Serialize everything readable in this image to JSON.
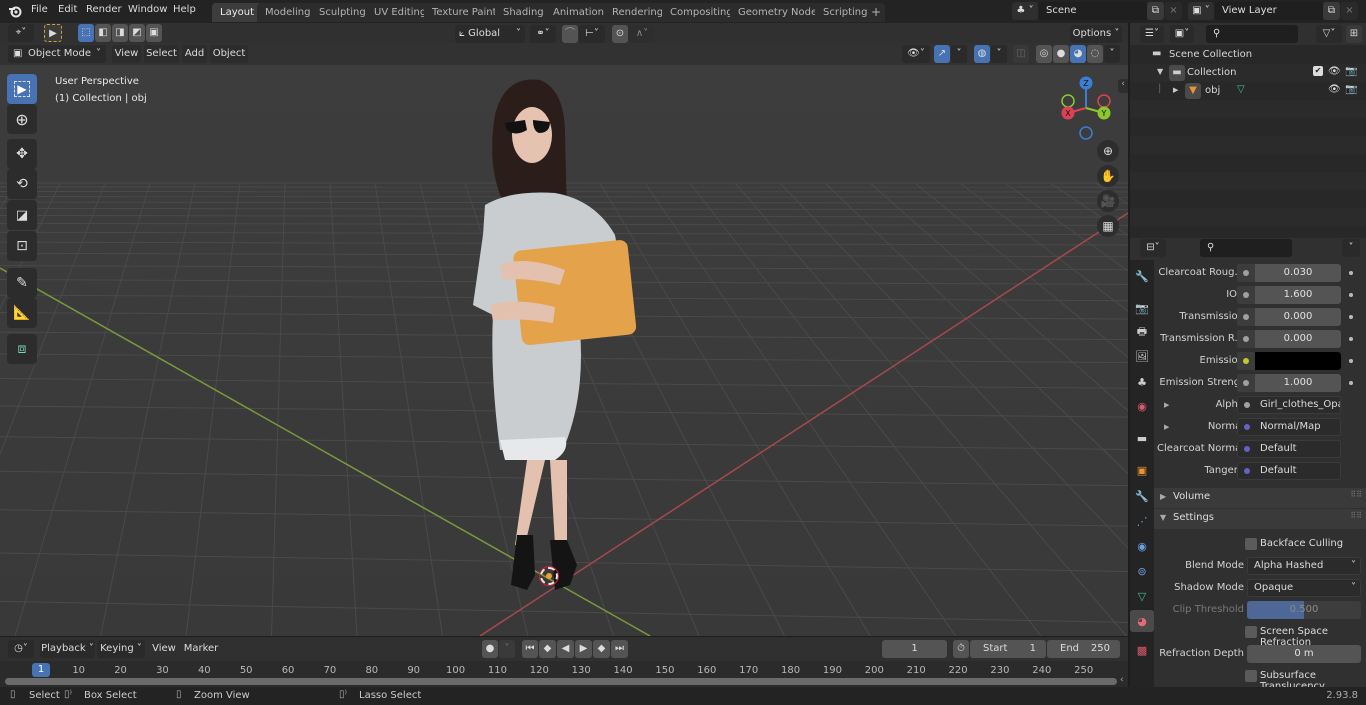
{
  "topbar": {
    "menus": [
      "File",
      "Edit",
      "Render",
      "Window",
      "Help"
    ],
    "workspaces": [
      "Layout",
      "Modeling",
      "Sculpting",
      "UV Editing",
      "Texture Paint",
      "Shading",
      "Animation",
      "Rendering",
      "Compositing",
      "Geometry Nodes",
      "Scripting"
    ],
    "active_workspace": "Layout",
    "add_workspace": "+",
    "scene_name": "Scene",
    "view_layer_name": "View Layer"
  },
  "viewport_header": {
    "mode": "Object Mode",
    "menus": [
      "View",
      "Select",
      "Add",
      "Object"
    ],
    "transform_orientation": "Global",
    "options_label": "Options"
  },
  "viewport": {
    "view_name": "User Perspective",
    "collection_info": "(1) Collection | obj",
    "gizmo_axes": [
      "X",
      "Y",
      "Z"
    ],
    "tools": [
      "select-box",
      "cursor",
      "move",
      "rotate",
      "scale",
      "transform",
      "annotate",
      "measure",
      "add-cube"
    ]
  },
  "outliner": {
    "root": "Scene Collection",
    "collection": "Collection",
    "object": "obj"
  },
  "properties": {
    "rows": [
      {
        "label": "Clearcoat Roug...",
        "value": "0.030",
        "type": "number"
      },
      {
        "label": "IOR",
        "value": "1.600",
        "type": "number"
      },
      {
        "label": "Transmission",
        "value": "0.000",
        "type": "number"
      },
      {
        "label": "Transmission R...",
        "value": "0.000",
        "type": "number"
      },
      {
        "label": "Emission",
        "value": "",
        "type": "color",
        "color": "#000000"
      },
      {
        "label": "Emission Strengt",
        "value": "1.000",
        "type": "number"
      }
    ],
    "links": [
      {
        "label": "Alpha",
        "value": "Girl_clothes_Opacity...",
        "socket_color": "#a1a1a1",
        "expandable": true
      },
      {
        "label": "Normal",
        "value": "Normal/Map",
        "socket_color": "#6363c7",
        "expandable": true
      },
      {
        "label": "Clearcoat Normal",
        "value": "Default",
        "socket_color": "#6363c7",
        "expandable": false
      },
      {
        "label": "Tangent",
        "value": "Default",
        "socket_color": "#6363c7",
        "expandable": false
      }
    ],
    "panels": {
      "volume": "Volume",
      "settings": "Settings"
    },
    "settings": {
      "backface_culling": "Backface Culling",
      "blend_mode_label": "Blend Mode",
      "blend_mode": "Alpha Hashed",
      "shadow_mode_label": "Shadow Mode",
      "shadow_mode": "Opaque",
      "clip_threshold_label": "Clip Threshold",
      "clip_threshold": "0.500",
      "clip_threshold_fraction": 0.5,
      "screen_space_refraction": "Screen Space Refraction",
      "refraction_depth_label": "Refraction Depth",
      "refraction_depth": "0 m",
      "subsurface_translucency": "Subsurface Translucency"
    }
  },
  "timeline": {
    "menus": [
      "Playback",
      "Keying",
      "View",
      "Marker"
    ],
    "current_frame": "1",
    "start_label": "Start",
    "start": "1",
    "end_label": "End",
    "end": "250",
    "ticks": [
      "1",
      "10",
      "20",
      "30",
      "40",
      "50",
      "60",
      "70",
      "80",
      "90",
      "100",
      "110",
      "120",
      "130",
      "140",
      "150",
      "160",
      "170",
      "180",
      "190",
      "200",
      "210",
      "220",
      "230",
      "240",
      "250"
    ]
  },
  "statusbar": {
    "hints": [
      "Select",
      "Box Select",
      "Zoom View",
      "Lasso Select"
    ],
    "version": "2.93.8"
  },
  "colors": {
    "accent": "#4772b3",
    "axis_x": "#e04055",
    "axis_y": "#8bc72f",
    "axis_z": "#3b7ed6",
    "emission": "#000000"
  }
}
